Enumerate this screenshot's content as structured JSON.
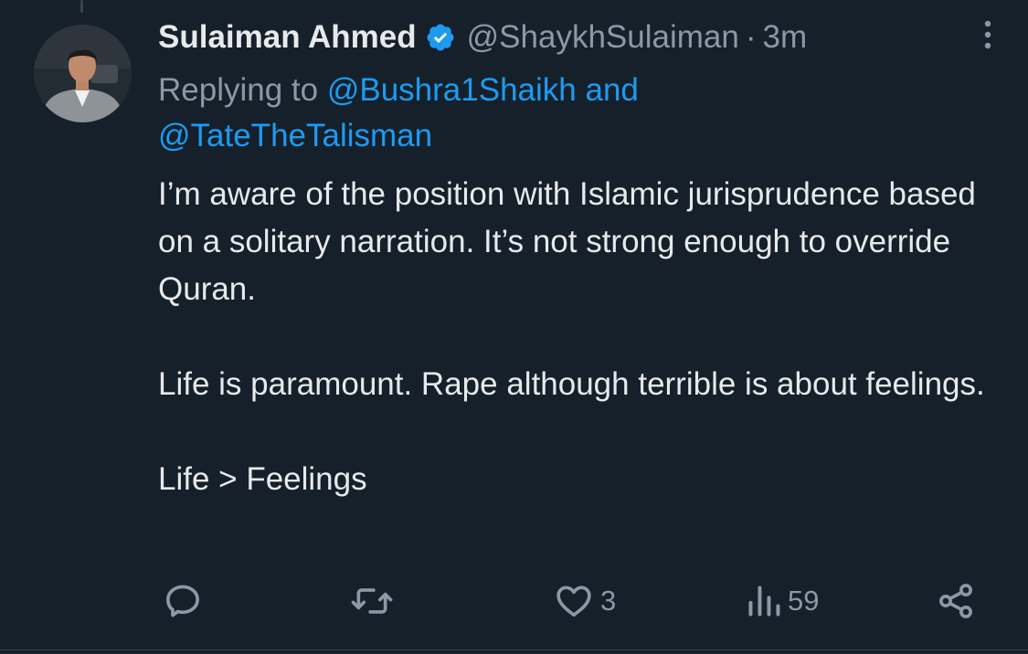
{
  "tweet": {
    "author": {
      "display_name": "Sulaiman Ahmed",
      "handle": "@ShaykhSulaiman",
      "verified": true,
      "avatar": "profile-photo"
    },
    "separator": "·",
    "timestamp": "3m",
    "reply": {
      "prefix": "Replying to",
      "mention_1": "@Bushra1Shaikh",
      "conjunction": "and",
      "mention_2": "@TateTheTalisman"
    },
    "body": {
      "paragraph_1": "I’m aware of the position with Islamic jurisprudence based on a solitary narration. It’s not strong enough to override Quran.",
      "paragraph_2": "Life is paramount. Rape although terrible is about feelings.",
      "paragraph_3": "Life > Feelings"
    },
    "actions": {
      "reply": {
        "icon": "reply-icon",
        "count": ""
      },
      "retweet": {
        "icon": "retweet-icon",
        "count": ""
      },
      "like": {
        "icon": "heart-icon",
        "count": "3"
      },
      "views": {
        "icon": "views-icon",
        "count": "59"
      },
      "share": {
        "icon": "share-icon"
      }
    }
  },
  "colors": {
    "background": "#15202b",
    "text_primary": "#e7e9ea",
    "text_secondary": "#8b98a5",
    "accent": "#1d9bf0"
  }
}
